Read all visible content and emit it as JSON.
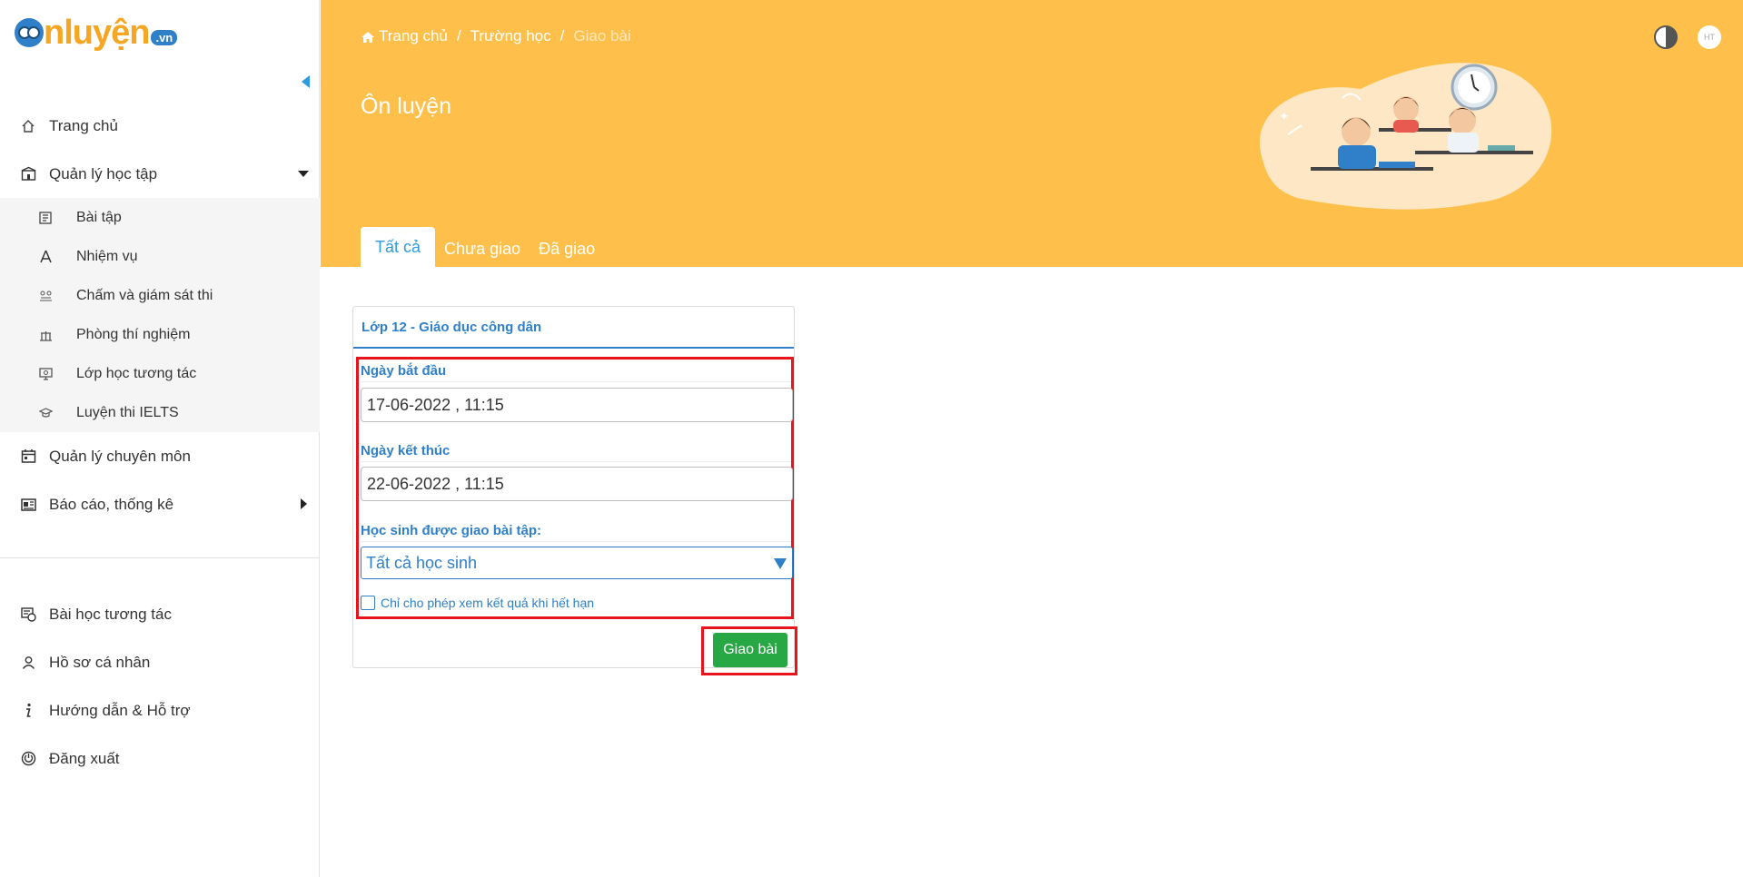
{
  "logo": {
    "text": "nluyện",
    "suffix": ".vn"
  },
  "sidebar": {
    "items": [
      {
        "label": "Trang chủ",
        "icon": "home-icon"
      },
      {
        "label": "Quản lý học tập",
        "icon": "school-icon",
        "expanded": true
      },
      {
        "label": "Quản lý chuyên môn",
        "icon": "calendar-icon"
      },
      {
        "label": "Báo cáo, thống kê",
        "icon": "report-icon"
      }
    ],
    "sub_items": [
      {
        "label": "Bài tập",
        "icon": "exercise-icon"
      },
      {
        "label": "Nhiệm vụ",
        "icon": "compass-icon"
      },
      {
        "label": "Chấm và giám sát thi",
        "icon": "exam-supervision-icon"
      },
      {
        "label": "Phòng thí nghiệm",
        "icon": "lab-icon"
      },
      {
        "label": "Lớp học tương tác",
        "icon": "interactive-class-icon"
      },
      {
        "label": "Luyện thi IELTS",
        "icon": "graduation-cap-icon"
      }
    ],
    "bottom_items": [
      {
        "label": "Bài học tương tác",
        "icon": "interactive-lesson-icon"
      },
      {
        "label": "Hồ sơ cá nhân",
        "icon": "user-icon"
      },
      {
        "label": "Hướng dẫn & Hỗ trợ",
        "icon": "info-icon"
      },
      {
        "label": "Đăng xuất",
        "icon": "power-icon"
      }
    ]
  },
  "header": {
    "breadcrumb": [
      "Trang chủ",
      "Trường học",
      "Giao bài"
    ],
    "title": "Ôn luyện",
    "avatar_text": "HT",
    "tabs": [
      "Tất cả",
      "Chưa giao",
      "Đã giao"
    ],
    "banner_color": "#fec04a"
  },
  "card": {
    "class_name": "Lớp 12 - Giáo dục công dân",
    "start_label": "Ngày bắt đầu",
    "start_value": "17-06-2022 , 11:15",
    "end_label": "Ngày kết thúc",
    "end_value": "22-06-2022 , 11:15",
    "students_label": "Học sinh được giao bài tập:",
    "students_value": "Tất cả học sinh",
    "checkbox_label": "Chỉ cho phép xem kết quả khi hết hạn",
    "submit_label": "Giao bài"
  },
  "colors": {
    "accent": "#2f80c8",
    "submit": "#28a745",
    "highlight": "#e8141c"
  }
}
